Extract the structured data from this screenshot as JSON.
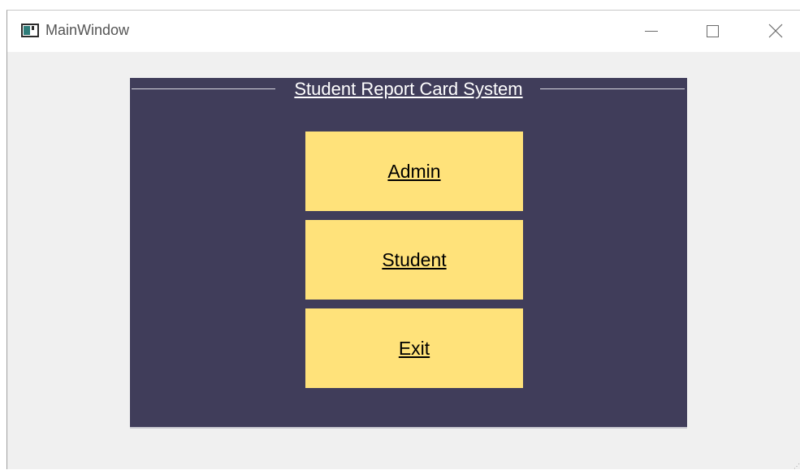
{
  "window": {
    "title": "MainWindow"
  },
  "group": {
    "title": "Student Report Card System"
  },
  "buttons": {
    "admin": "Admin",
    "student": "Student",
    "exit": "Exit"
  },
  "colors": {
    "panel": "#403d5a",
    "button": "#ffe27a",
    "window_bg": "#f0f0f0"
  },
  "icons": {
    "app": "app-window-icon",
    "minimize": "minimize-icon",
    "maximize": "maximize-icon",
    "close": "close-icon"
  }
}
